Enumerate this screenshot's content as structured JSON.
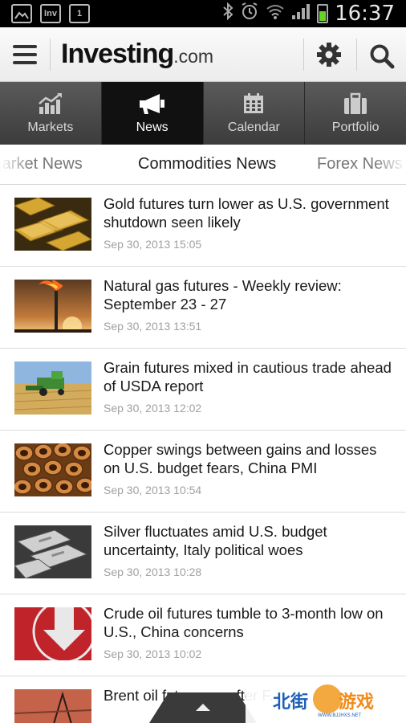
{
  "status_bar": {
    "time": "16:37",
    "notification_icons": [
      "image-icon",
      "inv-icon",
      "calendar-1-icon"
    ],
    "notif_inv": "Inv",
    "notif_one": "1",
    "system_icons": [
      "bluetooth-icon",
      "alarm-icon",
      "wifi-icon",
      "signal-icon",
      "battery-icon"
    ],
    "battery_color": "#6ad12a"
  },
  "header": {
    "logo_main": "Investing",
    "logo_suffix": ".com",
    "settings_icon": "gear-icon",
    "search_icon": "search-icon"
  },
  "tabs": [
    {
      "label": "Markets",
      "icon": "chart-icon"
    },
    {
      "label": "News",
      "icon": "megaphone-icon",
      "active": true
    },
    {
      "label": "Calendar",
      "icon": "calendar-icon"
    },
    {
      "label": "Portfolio",
      "icon": "briefcase-icon"
    }
  ],
  "subtabs": [
    {
      "label": "Market News"
    },
    {
      "label": "Commodities News",
      "active": true
    },
    {
      "label": "Forex News"
    }
  ],
  "news": [
    {
      "headline": "Gold futures turn lower as U.S. government shutdown seen likely",
      "date": "Sep 30, 2013 15:05",
      "thumb": "gold-bars"
    },
    {
      "headline": "Natural gas futures - Weekly review: September 23 - 27",
      "date": "Sep 30, 2013 13:51",
      "thumb": "gas-flare"
    },
    {
      "headline": "Grain futures mixed in cautious trade ahead of USDA report",
      "date": "Sep 30, 2013 12:02",
      "thumb": "harvester-field"
    },
    {
      "headline": "Copper swings between gains and losses on U.S. budget fears, China PMI",
      "date": "Sep 30, 2013 10:54",
      "thumb": "copper-pipes"
    },
    {
      "headline": "Silver fluctuates amid U.S. budget uncertainty, Italy political woes",
      "date": "Sep 30, 2013 10:28",
      "thumb": "silver-bars"
    },
    {
      "headline": "Crude oil futures tumble to 3-month low on U.S., China concerns",
      "date": "Sep 30, 2013 10:02",
      "thumb": "down-arrow"
    },
    {
      "headline": "Brent oil futures ... after F...",
      "date": "",
      "thumb": "oil-rig"
    }
  ],
  "watermark": {
    "text_left": "北街",
    "text_right": "游戏",
    "url": "WWW.BJJHXS.NET"
  },
  "colors": {
    "tab_bar": "#4a4a4a",
    "tab_active": "#111111",
    "date_text": "#a0a0a0",
    "watermark_blue": "#1d5fb8",
    "watermark_orange": "#f08a1b"
  }
}
